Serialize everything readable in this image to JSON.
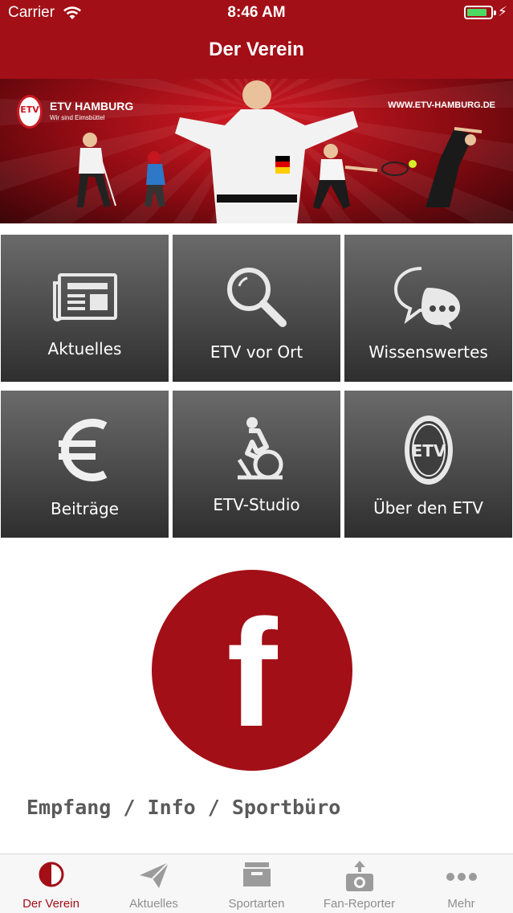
{
  "status": {
    "carrier": "Carrier",
    "time": "8:46 AM",
    "battery_level": 0.85
  },
  "nav": {
    "title": "Der Verein"
  },
  "banner": {
    "brand": "ETV HAMBURG",
    "tagline": "Wir sind Eimsbüttel",
    "url": "WWW.ETV-HAMBURG.DE",
    "logo_text": "ETV"
  },
  "tiles": [
    {
      "label": "Aktuelles",
      "icon": "newspaper-icon"
    },
    {
      "label": "ETV vor Ort",
      "icon": "magnifier-icon"
    },
    {
      "label": "Wissenswertes",
      "icon": "speech-bubbles-icon"
    },
    {
      "label": "Beiträge",
      "icon": "euro-icon"
    },
    {
      "label": "ETV-Studio",
      "icon": "exercise-bike-icon"
    },
    {
      "label": "Über den ETV",
      "icon": "etv-logo-icon"
    }
  ],
  "facebook": {
    "glyph": "f",
    "color": "#a30f17"
  },
  "section": {
    "title": "Empfang / Info / Sportbüro"
  },
  "tabbar": {
    "items": [
      {
        "label": "Der Verein",
        "icon": "club-icon",
        "active": true
      },
      {
        "label": "Aktuelles",
        "icon": "paper-plane-icon",
        "active": false
      },
      {
        "label": "Sportarten",
        "icon": "inbox-icon",
        "active": false
      },
      {
        "label": "Fan-Reporter",
        "icon": "camera-upload-icon",
        "active": false
      },
      {
        "label": "Mehr",
        "icon": "more-icon",
        "active": false
      }
    ]
  },
  "colors": {
    "brand": "#a30f17",
    "tile_top": "#6a6a6a",
    "tile_bottom": "#2e2e2e",
    "tab_inactive": "#8e8e8e"
  }
}
